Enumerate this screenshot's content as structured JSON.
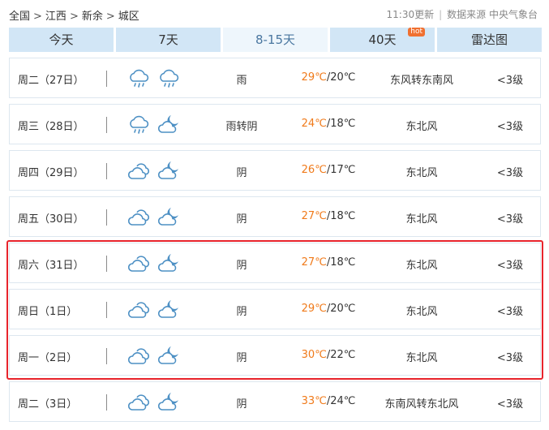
{
  "breadcrumb": {
    "items": [
      "全国",
      "江西",
      "新余",
      "城区"
    ],
    "separator": ">"
  },
  "update": {
    "time": "11:30更新",
    "source": "数据来源 中央气象台"
  },
  "tabs": [
    {
      "label": "今天"
    },
    {
      "label": "7天"
    },
    {
      "label": "8-15天",
      "active": true
    },
    {
      "label": "40天",
      "badge": "hot"
    },
    {
      "label": "雷达图"
    }
  ],
  "days": [
    {
      "day": "周二（27日）",
      "icons": [
        "rain-icon",
        "rain-icon"
      ],
      "condition": "雨",
      "high": "29℃",
      "low": "/20℃",
      "wind": "东风转东南风",
      "level": "<3级"
    },
    {
      "day": "周三（28日）",
      "icons": [
        "rain-icon",
        "cloudy-night-icon"
      ],
      "condition": "雨转阴",
      "high": "24℃",
      "low": "/18℃",
      "wind": "东北风",
      "level": "<3级"
    },
    {
      "day": "周四（29日）",
      "icons": [
        "overcast-icon",
        "cloudy-night-icon"
      ],
      "condition": "阴",
      "high": "26℃",
      "low": "/17℃",
      "wind": "东北风",
      "level": "<3级"
    },
    {
      "day": "周五（30日）",
      "icons": [
        "overcast-icon",
        "cloudy-night-icon"
      ],
      "condition": "阴",
      "high": "27℃",
      "low": "/18℃",
      "wind": "东北风",
      "level": "<3级"
    },
    {
      "day": "周六（31日）",
      "icons": [
        "overcast-icon",
        "cloudy-night-icon"
      ],
      "condition": "阴",
      "high": "27℃",
      "low": "/18℃",
      "wind": "东北风",
      "level": "<3级"
    },
    {
      "day": "周日（1日）",
      "icons": [
        "overcast-icon",
        "cloudy-night-icon"
      ],
      "condition": "阴",
      "high": "29℃",
      "low": "/20℃",
      "wind": "东北风",
      "level": "<3级"
    },
    {
      "day": "周一（2日）",
      "icons": [
        "overcast-icon",
        "cloudy-night-icon"
      ],
      "condition": "阴",
      "high": "30℃",
      "low": "/22℃",
      "wind": "东北风",
      "level": "<3级"
    },
    {
      "day": "周二（3日）",
      "icons": [
        "overcast-icon",
        "cloudy-night-icon"
      ],
      "condition": "阴",
      "high": "33℃",
      "low": "/24℃",
      "wind": "东南风转东北风",
      "level": "<3级"
    }
  ],
  "colors": {
    "high_temp": "#f07a1a",
    "highlight_border": "#e8242c",
    "tab_bg": "#d2e6f6",
    "icon": "#4d90c4"
  }
}
